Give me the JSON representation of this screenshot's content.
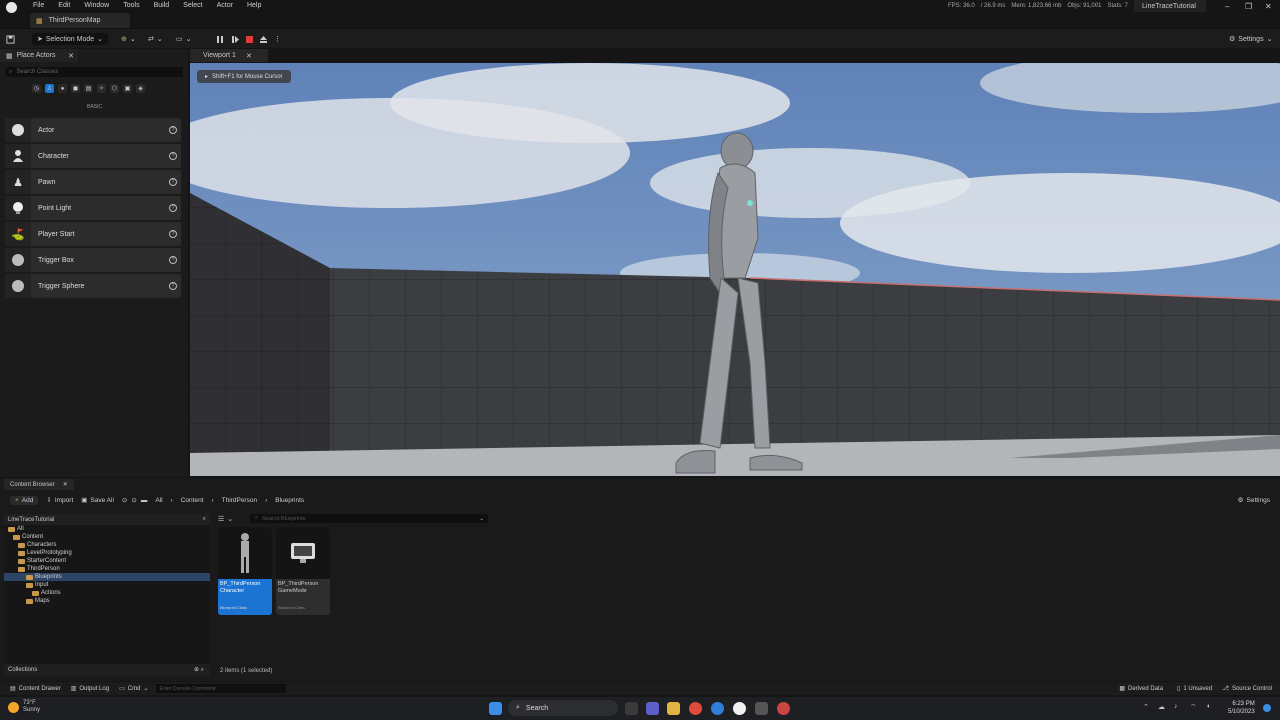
{
  "menu": [
    "File",
    "Edit",
    "Window",
    "Tools",
    "Build",
    "Select",
    "Actor",
    "Help"
  ],
  "map_tab": "ThirdPersonMap",
  "project_tab": "LineTraceTutorial",
  "stats": [
    "FPS: 36.0",
    "/ 26.9 ms",
    "Mem: 1,823.66 mb",
    "Objs: 91,001",
    "Stats: 7"
  ],
  "toolbar": {
    "selection_mode": "Selection Mode",
    "settings": "Settings"
  },
  "place_actors": {
    "tab": "Place Actors",
    "search_placeholder": "Search Classes",
    "category": "BASIC",
    "items": [
      {
        "label": "Actor",
        "icon": "sphere-icon"
      },
      {
        "label": "Character",
        "icon": "character-icon"
      },
      {
        "label": "Pawn",
        "icon": "pawn-icon"
      },
      {
        "label": "Point Light",
        "icon": "light-bulb-icon"
      },
      {
        "label": "Player Start",
        "icon": "player-start-icon"
      },
      {
        "label": "Trigger Box",
        "icon": "trigger-box-icon"
      },
      {
        "label": "Trigger Sphere",
        "icon": "trigger-sphere-icon"
      }
    ]
  },
  "viewport": {
    "tab": "Viewport 1",
    "hint": "Shift+F1 for Mouse Cursor"
  },
  "content_browser": {
    "tab": "Content Browser",
    "add": "Add",
    "import": "Import",
    "save_all": "Save All",
    "breadcrumbs": [
      "All",
      "Content",
      "ThirdPerson",
      "Blueprints"
    ],
    "settings": "Settings",
    "tree_root": "LineTraceTutorial",
    "tree": [
      "All",
      "Content",
      "Characters",
      "LevelPrototyping",
      "StarterContent",
      "ThirdPerson",
      "Blueprints",
      "Input",
      "Actions",
      "Maps"
    ],
    "search_placeholder": "Search Blueprints",
    "assets": [
      {
        "name": "BP_ThirdPerson Character",
        "kind": "Blueprint Class",
        "selected": true
      },
      {
        "name": "BP_ThirdPerson GameMode",
        "kind": "Blueprint Class",
        "selected": false
      }
    ],
    "collections": "Collections",
    "item_count": "2 items (1 selected)"
  },
  "status_bar": {
    "content_drawer": "Content Drawer",
    "output_log": "Output Log",
    "cmd": "Cmd",
    "cmd_placeholder": "Enter Console Command",
    "derived_data": "Derived Data",
    "unsaved": "1 Unsaved",
    "source_control": "Source Control"
  },
  "taskbar": {
    "temperature": "73°F",
    "weather": "Sunny",
    "search": "Search",
    "time": "6:23 PM",
    "date": "5/10/2023"
  },
  "colors": {
    "accent": "#1b74d1",
    "sky": "#6d8fbf",
    "wall": "#3b3c40"
  }
}
